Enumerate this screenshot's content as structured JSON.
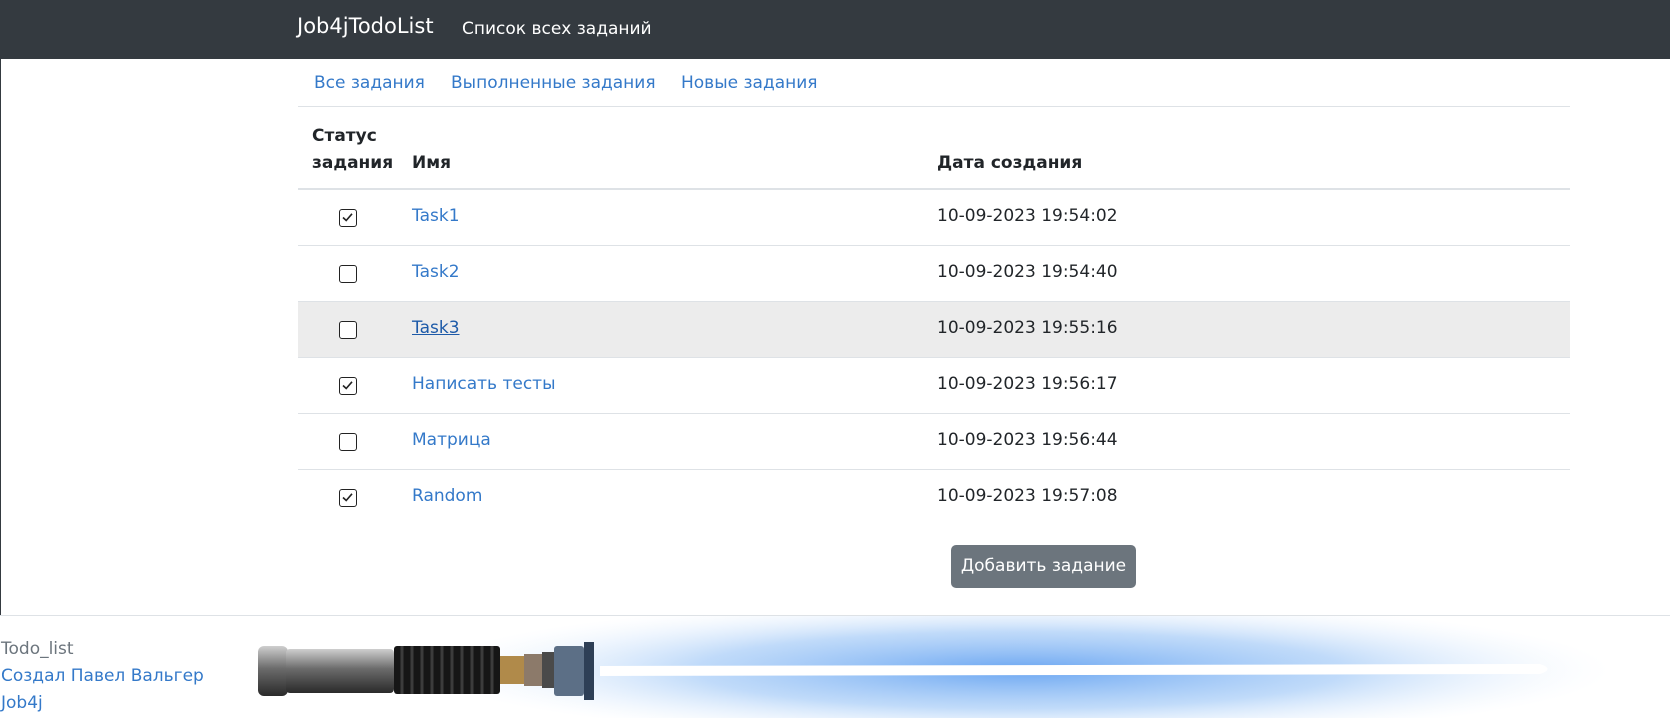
{
  "navbar": {
    "brand": "Job4jTodoList",
    "current_page": "Список всех заданий"
  },
  "tabs": [
    "Все задания",
    "Выполненные задания",
    "Новые задания"
  ],
  "table": {
    "headers": {
      "status": "Статус задания",
      "name": "Имя",
      "date": "Дата создания"
    },
    "rows": [
      {
        "done": true,
        "name": "Task1",
        "created": "10-09-2023 19:54:02"
      },
      {
        "done": false,
        "name": "Task2",
        "created": "10-09-2023 19:54:40"
      },
      {
        "done": false,
        "name": "Task3",
        "created": "10-09-2023 19:55:16"
      },
      {
        "done": true,
        "name": "Написать тесты",
        "created": "10-09-2023 19:56:17"
      },
      {
        "done": false,
        "name": "Матрица",
        "created": "10-09-2023 19:56:44"
      },
      {
        "done": true,
        "name": "Random",
        "created": "10-09-2023 19:57:08"
      }
    ]
  },
  "add_button": "Добавить задание",
  "footer": {
    "title": "Todo_list",
    "author": "Создал Павел Вальгер",
    "school": "Job4j"
  },
  "colors": {
    "navbar": "#343a40",
    "link": "#3479c9",
    "button": "#6c757d",
    "hover_row": "#ececec",
    "saber_glow": "#5a9cf0"
  }
}
